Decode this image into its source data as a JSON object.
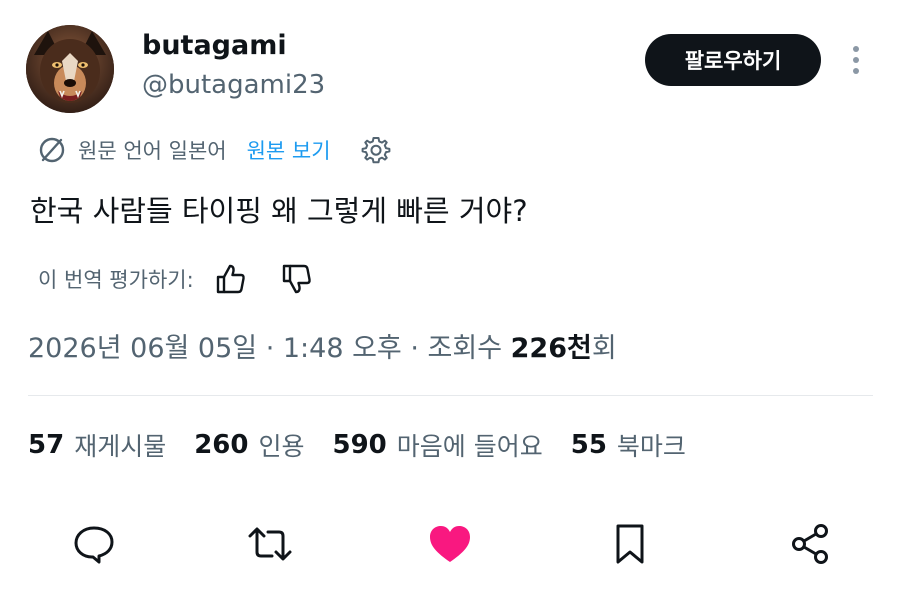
{
  "author": {
    "display_name": "butagami",
    "handle": "@butagami23",
    "follow_label": "팔로우하기"
  },
  "translation": {
    "original_language": "원문 언어 일본어",
    "show_original_label": "원본 보기"
  },
  "tweet": {
    "text": "한국 사람들 타이핑 왜 그렇게 빠른 거야?"
  },
  "rate_translation": {
    "label": "이 번역 평가하기:"
  },
  "meta": {
    "date": "2026년 06월 05일",
    "separator": " · ",
    "time": "1:48 오후",
    "views_prefix": "조회수 ",
    "views_count": "226천",
    "views_suffix": "회"
  },
  "stats": {
    "reposts": {
      "count": "57",
      "label": "재게시물"
    },
    "quotes": {
      "count": "260",
      "label": "인용"
    },
    "likes": {
      "count": "590",
      "label": "마음에 들어요"
    },
    "bookmarks": {
      "count": "55",
      "label": "북마크"
    }
  },
  "colors": {
    "text_primary": "#0f1419",
    "text_secondary": "#536471",
    "link": "#1d9bf0",
    "like_active": "#f91880",
    "button_bg": "#0f1419"
  },
  "icons": [
    "reply-icon",
    "repost-icon",
    "like-icon",
    "bookmark-icon",
    "share-icon",
    "gear-icon",
    "translate-icon",
    "thumbs-up-icon",
    "thumbs-down-icon"
  ]
}
